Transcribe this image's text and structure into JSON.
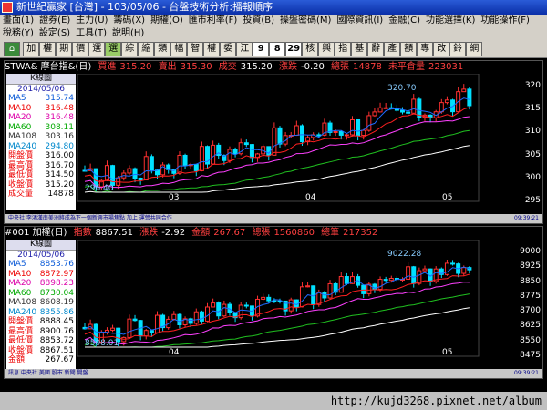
{
  "window": {
    "title": "新世紀贏家 [台灣] - 103/05/06 - 台盤技術分析:播報順序"
  },
  "menus": {
    "row1": [
      "畫面(1)",
      "證券(E)",
      "主力(U)",
      "籌碼(X)",
      "期權(O)",
      "匯市利率(F)",
      "投資(B)",
      "操盤密碼(M)",
      "國際資訊(I)",
      "金融(C)",
      "功能選擇(K)",
      "功能操作(F)"
    ],
    "row2": [
      "稅務(Y)",
      "設定(S)",
      "工具(T)",
      "說明(H)"
    ]
  },
  "toolbar": [
    "加",
    "權",
    "期",
    "價",
    "選",
    "選",
    "綜",
    "縮",
    "類",
    "幅",
    "智",
    "權",
    "委",
    "江",
    "9",
    "8",
    "29",
    "核",
    "興",
    "指",
    "基",
    "辭",
    "產",
    "額",
    "專",
    "改",
    "鈴",
    "網"
  ],
  "panel1": {
    "quote": {
      "name": "STWA& 摩台指&(日)",
      "buy_label": "買進",
      "buy": "315.20",
      "sell_label": "賣出",
      "sell": "315.30",
      "deal_label": "成交",
      "deal": "315.20",
      "chg_label": "漲跌",
      "chg": "-0.20",
      "vol_label": "總張",
      "vol": "14878",
      "oi_label": "未平倉量",
      "oi": "223031"
    },
    "info": {
      "header": "K線圖",
      "date": "2014/05/06",
      "rows": [
        {
          "label": "MA5",
          "value": "315.74"
        },
        {
          "label": "MA10",
          "value": "316.48"
        },
        {
          "label": "MA20",
          "value": "316.48"
        },
        {
          "label": "MA60",
          "value": "308.11"
        },
        {
          "label": "MA108",
          "value": "303.16"
        },
        {
          "label": "MA240",
          "value": "294.80"
        },
        {
          "label": "開盤價",
          "value": "316.00"
        },
        {
          "label": "最高價",
          "value": "316.70"
        },
        {
          "label": "最低價",
          "value": "314.50"
        },
        {
          "label": "收盤價",
          "value": "315.20"
        },
        {
          "label": "成交量",
          "value": "14878"
        }
      ]
    },
    "axis_ticks": [
      "320",
      "315",
      "310",
      "305",
      "300",
      "295"
    ],
    "x_labels": [
      "03",
      "04",
      "05"
    ],
    "annotations": [
      "320.70",
      "296.40"
    ],
    "status": "中央社 李鴻漢南美洲將成為下一個新興市場焦點 加上 運營共同合作",
    "status_right": "09:39:21"
  },
  "panel2": {
    "quote": {
      "name": "#001 加權(日)",
      "idx_label": "指數",
      "idx": "8867.51",
      "chg_label": "漲跌",
      "chg": "-2.92",
      "amt_label": "金額",
      "amt": "267.67",
      "vol_label": "總張",
      "vol": "1560860",
      "cnt_label": "總筆",
      "cnt": "217352"
    },
    "info": {
      "header": "K線圖",
      "date": "2014/05/06",
      "rows": [
        {
          "label": "MA5",
          "value": "8853.76"
        },
        {
          "label": "MA10",
          "value": "8872.97"
        },
        {
          "label": "MA20",
          "value": "8898.23"
        },
        {
          "label": "MA60",
          "value": "8730.04"
        },
        {
          "label": "MA108",
          "value": "8608.19"
        },
        {
          "label": "MA240",
          "value": "8355.86"
        },
        {
          "label": "開盤價",
          "value": "8888.45"
        },
        {
          "label": "最高價",
          "value": "8900.76"
        },
        {
          "label": "最低價",
          "value": "8853.72"
        },
        {
          "label": "收盤價",
          "value": "8867.51"
        },
        {
          "label": "金額",
          "value": "267.67"
        }
      ]
    },
    "axis_ticks": [
      "9000",
      "8925",
      "8850",
      "8775",
      "8700",
      "8625",
      "8550",
      "8475"
    ],
    "x_labels": [
      "04",
      "05"
    ],
    "annotations": [
      "9022.28",
      "8508.01"
    ],
    "status": "訊息 中央社 美國 股市 新聞 開盤",
    "status_right": "09:39:21"
  },
  "watermark": "http://kujd3268.pixnet.net/album",
  "colors": {
    "up": "#ff3030",
    "down": "#00e0ff",
    "ma5": "#1e6bff",
    "ma10": "#ff2020",
    "ma20": "#ff40ff",
    "ma60": "#20c020",
    "ma108": "#ffffff"
  }
}
